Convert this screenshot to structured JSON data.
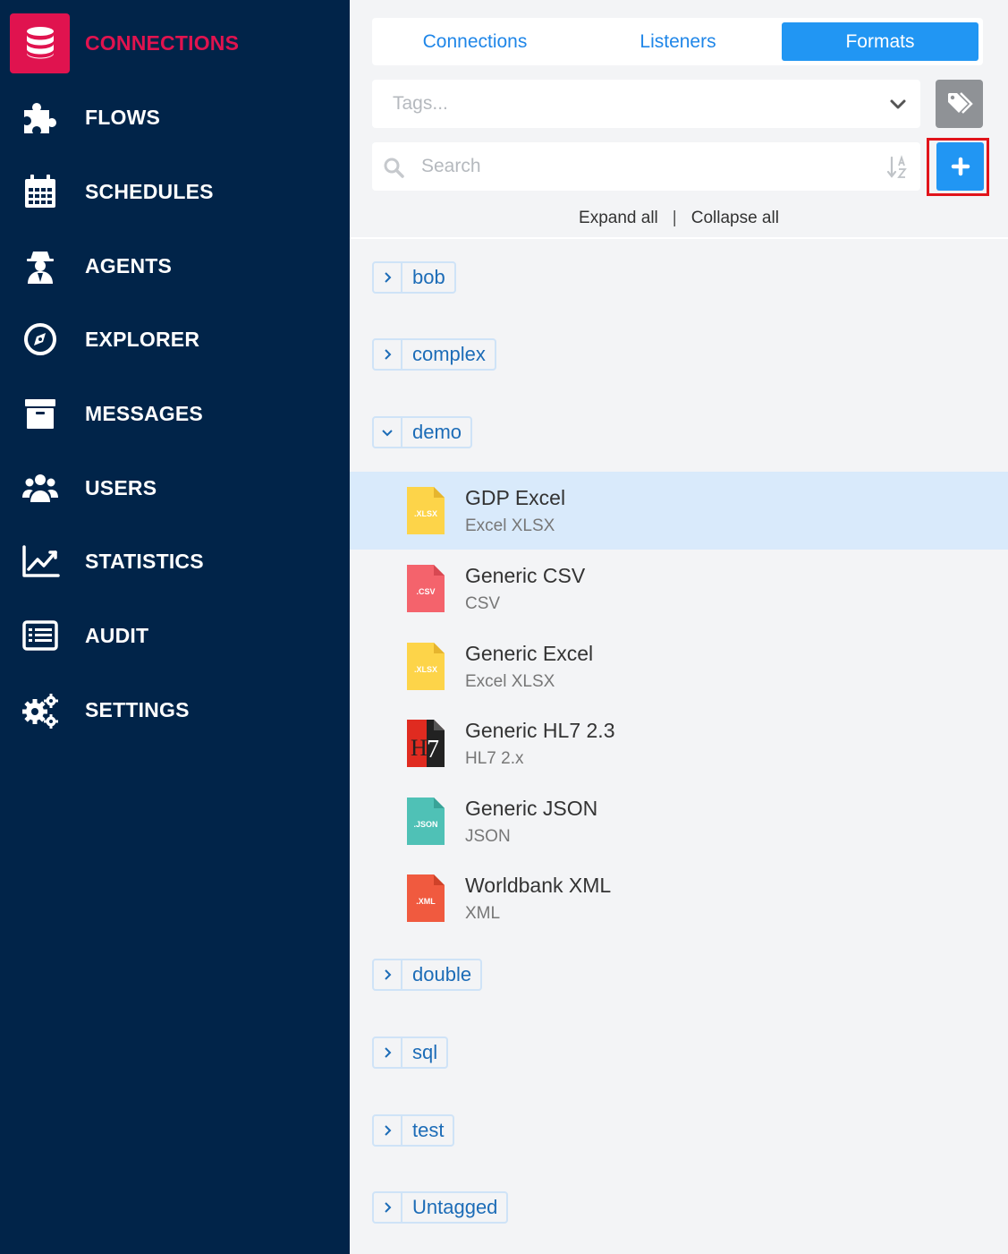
{
  "sidebar": {
    "items": [
      {
        "label": "CONNECTIONS",
        "icon": "database-icon",
        "active": true
      },
      {
        "label": "FLOWS",
        "icon": "puzzle-icon"
      },
      {
        "label": "SCHEDULES",
        "icon": "calendar-icon"
      },
      {
        "label": "AGENTS",
        "icon": "agent-icon"
      },
      {
        "label": "EXPLORER",
        "icon": "compass-icon"
      },
      {
        "label": "MESSAGES",
        "icon": "archive-icon"
      },
      {
        "label": "USERS",
        "icon": "users-icon"
      },
      {
        "label": "STATISTICS",
        "icon": "chart-line-icon"
      },
      {
        "label": "AUDIT",
        "icon": "list-icon"
      },
      {
        "label": "SETTINGS",
        "icon": "gears-icon"
      }
    ]
  },
  "tabs": [
    {
      "label": "Connections"
    },
    {
      "label": "Listeners"
    },
    {
      "label": "Formats",
      "active": true
    }
  ],
  "tags": {
    "placeholder": "Tags..."
  },
  "search": {
    "placeholder": "Search",
    "value": ""
  },
  "actions": {
    "expand_all": "Expand all",
    "separator": "|",
    "collapse_all": "Collapse all"
  },
  "groups": {
    "bob": "bob",
    "complex": "complex",
    "demo": "demo",
    "double": "double",
    "sql": "sql",
    "test": "test",
    "untagged": "Untagged"
  },
  "formats": [
    {
      "name": "GDP Excel",
      "type": "Excel XLSX",
      "icon_text": ".XLSX",
      "color": "#fdd449",
      "selected": true
    },
    {
      "name": "Generic CSV",
      "type": "CSV",
      "icon_text": ".CSV",
      "color": "#f4636c"
    },
    {
      "name": "Generic Excel",
      "type": "Excel XLSX",
      "icon_text": ".XLSX",
      "color": "#fdd449"
    },
    {
      "name": "Generic HL7 2.3",
      "type": "HL7 2.x",
      "icon_text": "H7",
      "color": "#e02b20"
    },
    {
      "name": "Generic JSON",
      "type": "JSON",
      "icon_text": ".JSON",
      "color": "#4fc1b6"
    },
    {
      "name": "Worldbank XML",
      "type": "XML",
      "icon_text": ".XML",
      "color": "#f05a3f"
    }
  ],
  "colors": {
    "sidebar_bg": "#012449",
    "accent": "#e0134f",
    "primary": "#2196f3",
    "highlight_border": "#e1141b"
  }
}
